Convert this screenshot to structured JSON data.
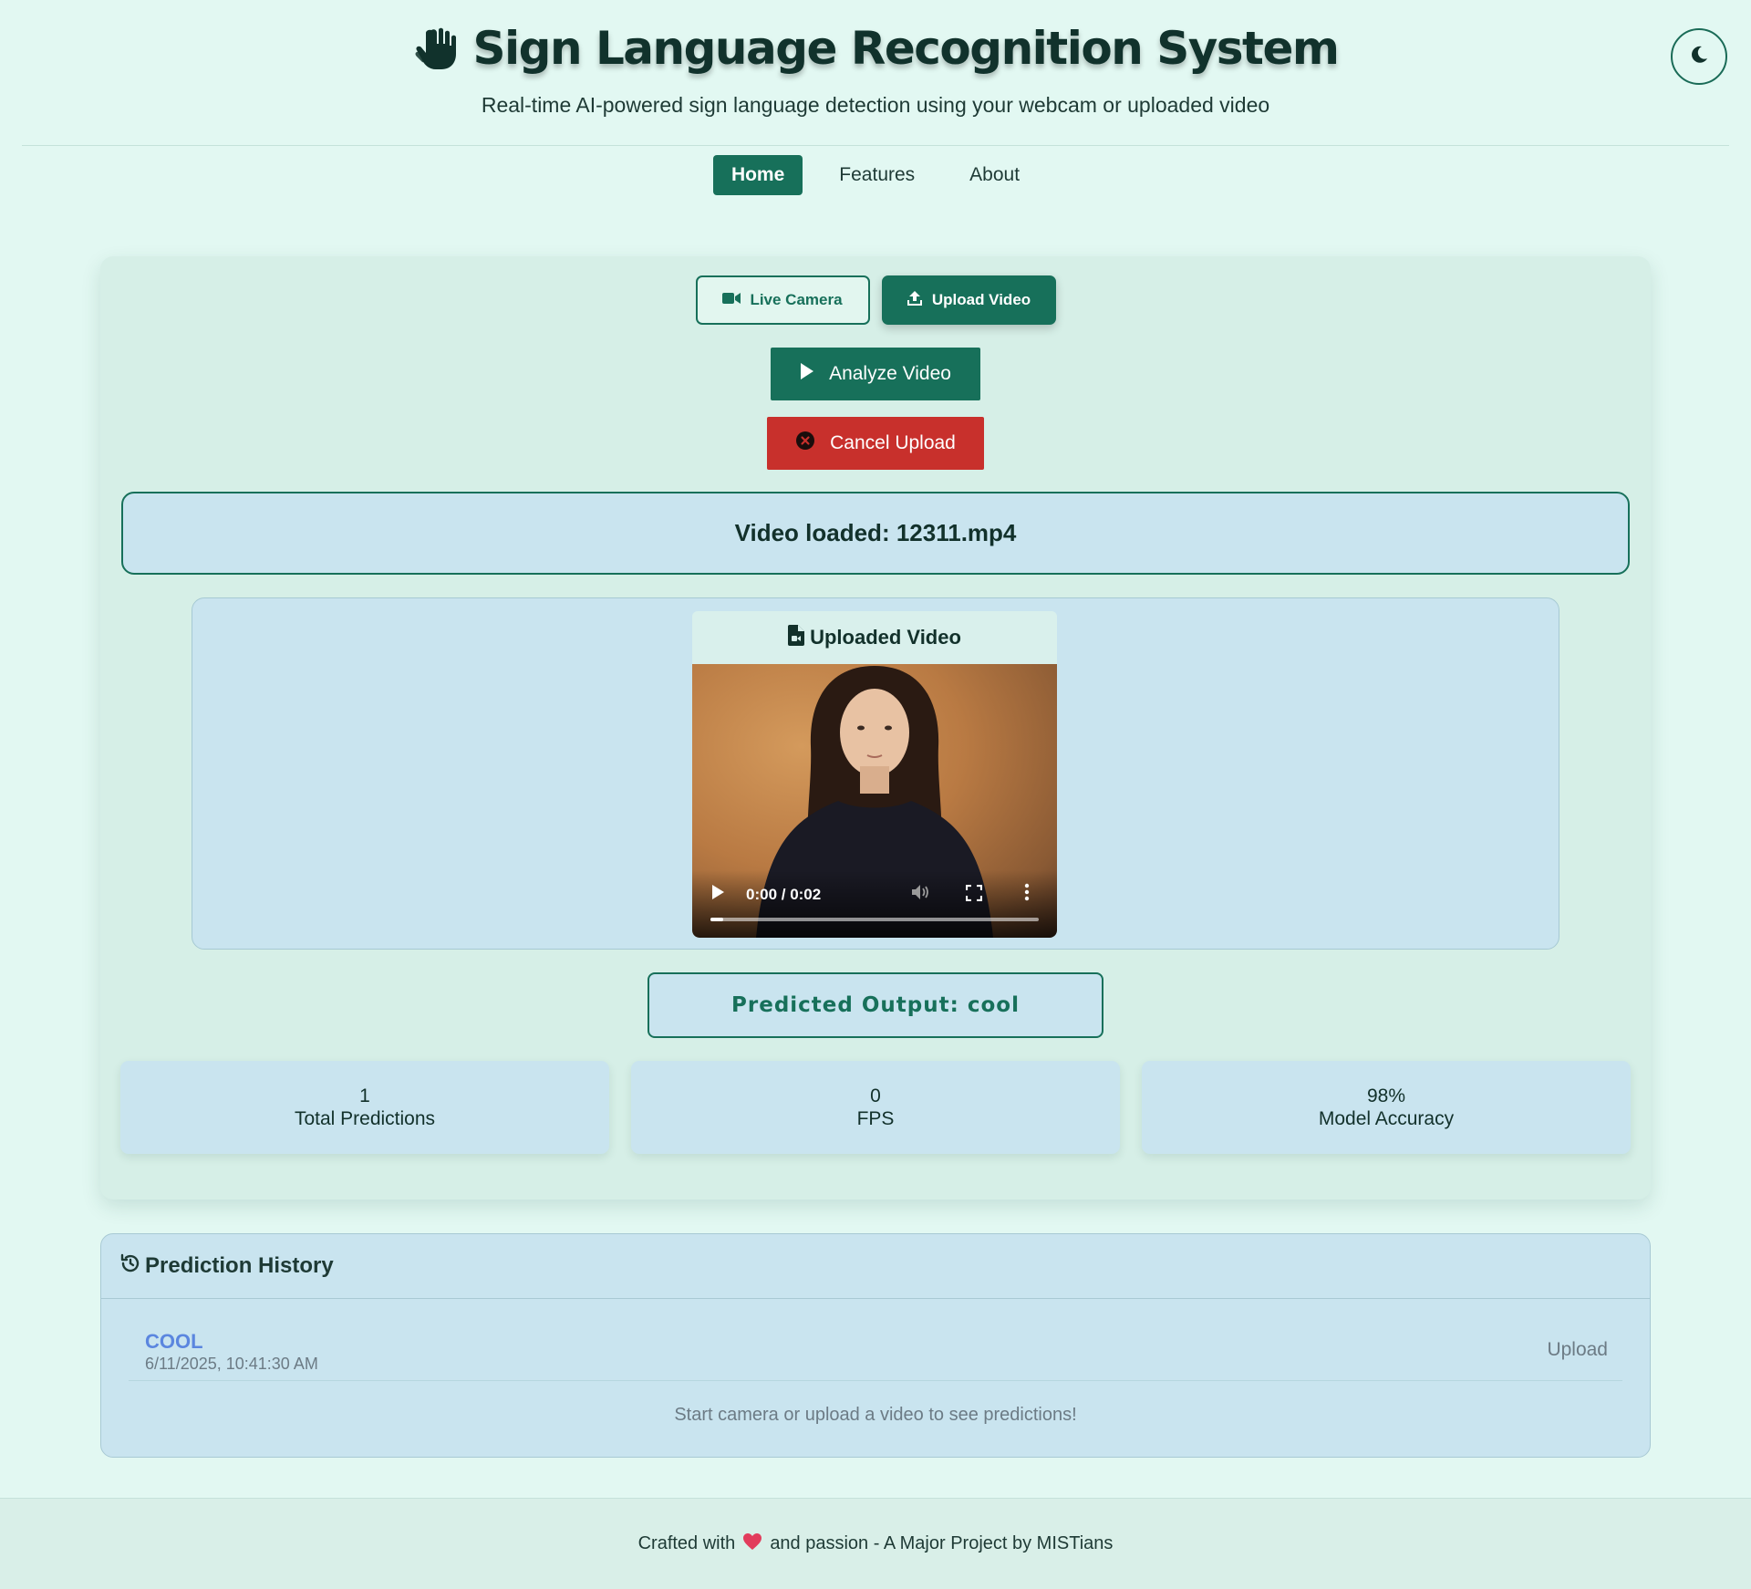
{
  "header": {
    "title": "Sign Language Recognition System",
    "subtitle": "Real-time AI-powered sign language detection using your webcam or uploaded video",
    "title_icon": "hand-sign-icon",
    "theme_toggle_icon": "moon-icon"
  },
  "nav": {
    "items": [
      {
        "label": "Home",
        "active": true
      },
      {
        "label": "Features",
        "active": false
      },
      {
        "label": "About",
        "active": false
      }
    ]
  },
  "controls": {
    "live_camera_label": "Live Camera",
    "upload_video_label": "Upload Video",
    "analyze_label": "Analyze Video",
    "cancel_label": "Cancel Upload"
  },
  "status": {
    "message": "Video loaded: 12311.mp4"
  },
  "video": {
    "header": "Uploaded Video",
    "time": "0:00 / 0:02",
    "progress": 0.04
  },
  "prediction": {
    "label": "Predicted Output: cool"
  },
  "stats": [
    {
      "value": "1",
      "label": "Total Predictions"
    },
    {
      "value": "0",
      "label": "FPS"
    },
    {
      "value": "98%",
      "label": "Model Accuracy"
    }
  ],
  "history": {
    "title": "Prediction History",
    "items": [
      {
        "prediction": "COOL",
        "timestamp": "6/11/2025, 10:41:30 AM",
        "source": "Upload"
      }
    ],
    "empty_message": "Start camera or upload a video to see predictions!"
  },
  "footer": {
    "prefix": "Crafted with",
    "suffix": "and passion - A Major Project by MISTians"
  },
  "colors": {
    "background": "#e2f8f2",
    "primary": "#17705a",
    "danger": "#c8302c",
    "card": "#c9e4ef",
    "history_accent": "#5b86df"
  }
}
